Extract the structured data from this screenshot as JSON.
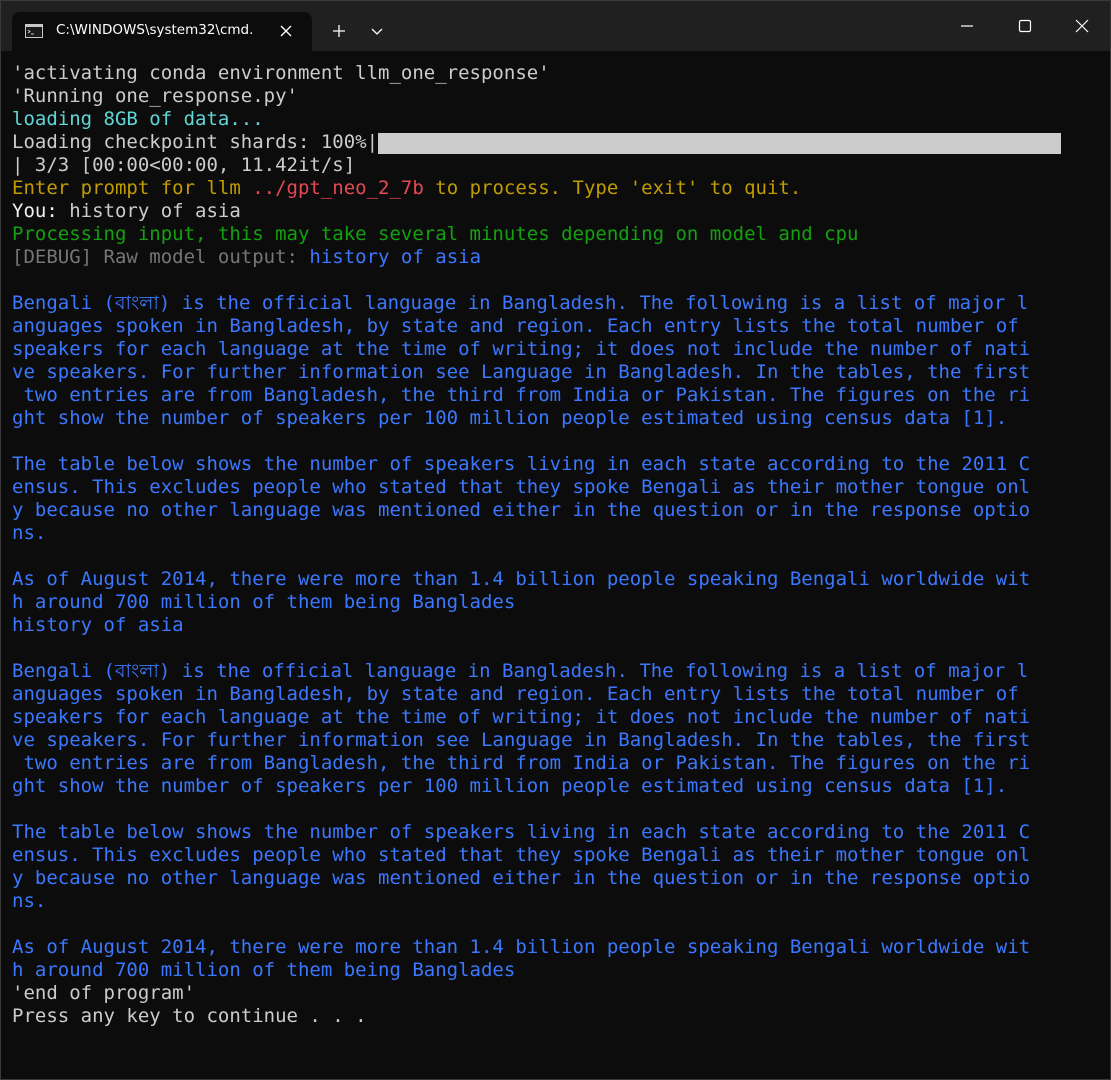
{
  "window": {
    "tab_title": "C:\\WINDOWS\\system32\\cmd.",
    "icons": {
      "tab": "command-prompt-icon",
      "tab_close": "close-icon",
      "new_tab": "plus-icon",
      "dropdown": "chevron-down-icon",
      "minimize": "minimize-icon",
      "maximize": "maximize-icon",
      "close": "close-icon"
    }
  },
  "colors": {
    "background": "#0c0c0c",
    "titlebar": "#202020",
    "default_text": "#cccccc",
    "cyan": "#61d6d6",
    "yellow": "#c19c00",
    "red": "#e74856",
    "green": "#13a10e",
    "gray": "#767676",
    "blue": "#3b78ff"
  },
  "terminal": {
    "lines": [
      {
        "segments": [
          {
            "text": "'activating conda environment llm_one_response'",
            "color": "white"
          }
        ]
      },
      {
        "segments": [
          {
            "text": "'Running one_response.py'",
            "color": "white"
          }
        ]
      },
      {
        "segments": [
          {
            "text": "loading 8GB of data...",
            "color": "cyan"
          }
        ]
      },
      {
        "segments": [
          {
            "text": "Loading checkpoint shards: 100%|",
            "color": "white"
          }
        ],
        "progress": 1.0
      },
      {
        "segments": [
          {
            "text": "| 3/3 [00:00<00:00, 11.42it/s]",
            "color": "white"
          }
        ]
      },
      {
        "segments": [
          {
            "text": "Enter prompt for llm ",
            "color": "yellow"
          },
          {
            "text": "../gpt_neo_2_7b",
            "color": "red"
          },
          {
            "text": " to process. Type 'exit' to quit.",
            "color": "yellow"
          }
        ]
      },
      {
        "segments": [
          {
            "text": "You:",
            "color": "bright"
          },
          {
            "text": " history of asia",
            "color": "white"
          }
        ]
      },
      {
        "segments": [
          {
            "text": "Processing input, this may take several minutes depending on model and cpu",
            "color": "green"
          }
        ]
      },
      {
        "segments": [
          {
            "text": "[DEBUG] Raw model output: ",
            "color": "gray"
          },
          {
            "text": "history of asia",
            "color": "blue"
          }
        ]
      },
      {
        "segments": [
          {
            "text": "",
            "color": "white"
          }
        ]
      },
      {
        "segments": [
          {
            "text": "Bengali (বাংলা) is the official language in Bangladesh. The following is a list of major l",
            "color": "blue"
          }
        ]
      },
      {
        "segments": [
          {
            "text": "anguages spoken in Bangladesh, by state and region. Each entry lists the total number of ",
            "color": "blue"
          }
        ]
      },
      {
        "segments": [
          {
            "text": "speakers for each language at the time of writing; it does not include the number of nati",
            "color": "blue"
          }
        ]
      },
      {
        "segments": [
          {
            "text": "ve speakers. For further information see Language in Bangladesh. In the tables, the first",
            "color": "blue"
          }
        ]
      },
      {
        "segments": [
          {
            "text": " two entries are from Bangladesh, the third from India or Pakistan. The figures on the ri",
            "color": "blue"
          }
        ]
      },
      {
        "segments": [
          {
            "text": "ght show the number of speakers per 100 million people estimated using census data [1].",
            "color": "blue"
          }
        ]
      },
      {
        "segments": [
          {
            "text": "",
            "color": "blue"
          }
        ]
      },
      {
        "segments": [
          {
            "text": "The table below shows the number of speakers living in each state according to the 2011 C",
            "color": "blue"
          }
        ]
      },
      {
        "segments": [
          {
            "text": "ensus. This excludes people who stated that they spoke Bengali as their mother tongue onl",
            "color": "blue"
          }
        ]
      },
      {
        "segments": [
          {
            "text": "y because no other language was mentioned either in the question or in the response optio",
            "color": "blue"
          }
        ]
      },
      {
        "segments": [
          {
            "text": "ns.",
            "color": "blue"
          }
        ]
      },
      {
        "segments": [
          {
            "text": "",
            "color": "blue"
          }
        ]
      },
      {
        "segments": [
          {
            "text": "As of August 2014, there were more than 1.4 billion people speaking Bengali worldwide wit",
            "color": "blue"
          }
        ]
      },
      {
        "segments": [
          {
            "text": "h around 700 million of them being Banglades",
            "color": "blue"
          }
        ]
      },
      {
        "segments": [
          {
            "text": "history of asia",
            "color": "blue"
          }
        ]
      },
      {
        "segments": [
          {
            "text": "",
            "color": "blue"
          }
        ]
      },
      {
        "segments": [
          {
            "text": "Bengali (বাংলা) is the official language in Bangladesh. The following is a list of major l",
            "color": "blue"
          }
        ]
      },
      {
        "segments": [
          {
            "text": "anguages spoken in Bangladesh, by state and region. Each entry lists the total number of ",
            "color": "blue"
          }
        ]
      },
      {
        "segments": [
          {
            "text": "speakers for each language at the time of writing; it does not include the number of nati",
            "color": "blue"
          }
        ]
      },
      {
        "segments": [
          {
            "text": "ve speakers. For further information see Language in Bangladesh. In the tables, the first",
            "color": "blue"
          }
        ]
      },
      {
        "segments": [
          {
            "text": " two entries are from Bangladesh, the third from India or Pakistan. The figures on the ri",
            "color": "blue"
          }
        ]
      },
      {
        "segments": [
          {
            "text": "ght show the number of speakers per 100 million people estimated using census data [1].",
            "color": "blue"
          }
        ]
      },
      {
        "segments": [
          {
            "text": "",
            "color": "blue"
          }
        ]
      },
      {
        "segments": [
          {
            "text": "The table below shows the number of speakers living in each state according to the 2011 C",
            "color": "blue"
          }
        ]
      },
      {
        "segments": [
          {
            "text": "ensus. This excludes people who stated that they spoke Bengali as their mother tongue onl",
            "color": "blue"
          }
        ]
      },
      {
        "segments": [
          {
            "text": "y because no other language was mentioned either in the question or in the response optio",
            "color": "blue"
          }
        ]
      },
      {
        "segments": [
          {
            "text": "ns.",
            "color": "blue"
          }
        ]
      },
      {
        "segments": [
          {
            "text": "",
            "color": "blue"
          }
        ]
      },
      {
        "segments": [
          {
            "text": "As of August 2014, there were more than 1.4 billion people speaking Bengali worldwide wit",
            "color": "blue"
          }
        ]
      },
      {
        "segments": [
          {
            "text": "h around 700 million of them being Banglades",
            "color": "blue"
          }
        ]
      },
      {
        "segments": [
          {
            "text": "'end of program'",
            "color": "white"
          }
        ]
      },
      {
        "segments": [
          {
            "text": "Press any key to continue . . .",
            "color": "white"
          }
        ]
      }
    ]
  }
}
